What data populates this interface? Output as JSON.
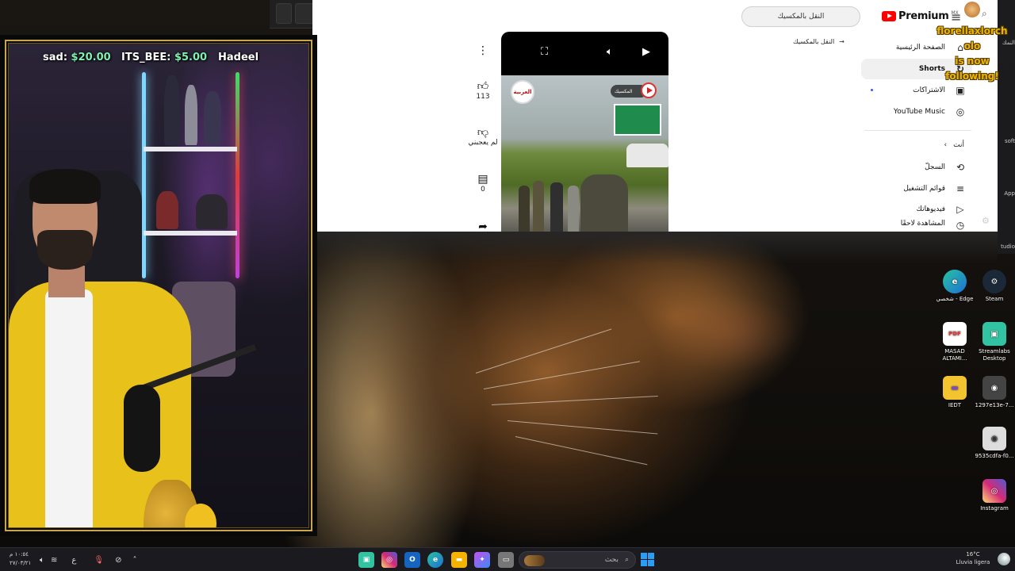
{
  "browser": {
    "address_text": "النقل بالمكسيك"
  },
  "youtube": {
    "logo_text": "Premium",
    "region": "MX",
    "back_link": "النقل بالمكسيك",
    "sidebar": [
      {
        "label": "الصفحة الرئيسية",
        "icon": "home-icon",
        "glyph": "⌂"
      },
      {
        "label": "Shorts",
        "icon": "shorts-icon",
        "glyph": "↻"
      },
      {
        "label": "الاشتراكات",
        "icon": "subscriptions-icon",
        "glyph": "▣"
      },
      {
        "label": "YouTube Music",
        "icon": "music-icon",
        "glyph": "◎"
      }
    ],
    "you_section": {
      "label": "أنت",
      "chevron": "‹"
    },
    "you_items": [
      {
        "label": "السجلّ",
        "icon": "history-icon",
        "glyph": "⟲"
      },
      {
        "label": "قوائم التشغيل",
        "icon": "playlists-icon",
        "glyph": "≡"
      },
      {
        "label": "فيديوهاتك",
        "icon": "your-videos-icon",
        "glyph": "▷"
      },
      {
        "label": "المشاهدة لاحقًا",
        "icon": "watch-later-icon",
        "glyph": "◷"
      }
    ],
    "short": {
      "channel_logo": "العربية",
      "tag": "المكسيك",
      "like_count": "113",
      "dislike_label": "لم يعجبني",
      "comment_count": "0"
    }
  },
  "stream": {
    "donors": [
      {
        "name": "sad:",
        "amount": "$20.00"
      },
      {
        "name": "ITS_BEE:",
        "amount": "$5.00"
      },
      {
        "name": "Hadeel",
        "amount": ""
      }
    ],
    "follow_alert": {
      "lines": [
        "florellaxlorch",
        "olo",
        "is now",
        "following!"
      ]
    }
  },
  "desktop": {
    "partial_labels": [
      "النمك",
      "soft",
      "App",
      "tudio"
    ],
    "icons": [
      {
        "label": "شخصي - Edge",
        "glyph": "e",
        "color": "#1e88d6"
      },
      {
        "label": "Steam",
        "glyph": "⚙",
        "color": "#1b2838"
      },
      {
        "label": "MASAD ALTAMI...",
        "glyph": "PDF",
        "color": "#e53935"
      },
      {
        "label": "Streamlabs Desktop",
        "glyph": "▣",
        "color": "#31c3a2"
      },
      {
        "label": "IEDT",
        "glyph": "▬",
        "color": "#f4c430"
      },
      {
        "label": "1297e13e-7...",
        "glyph": "◉",
        "color": "#444444"
      },
      {
        "label": "9535cdfa-f0...",
        "glyph": "◉",
        "color": "#dddddd"
      },
      {
        "label": "Instagram",
        "glyph": "◎",
        "color": "#d62976"
      }
    ]
  },
  "taskbar": {
    "search_placeholder": "بحث",
    "clock_time": "١٠:٥٤ م",
    "clock_date": "٢٧/٠٣/٢١",
    "weather_temp": "16°C",
    "weather_desc": "Lluvia ligera",
    "lang": "ع"
  },
  "colors": {
    "frame_gold": "#c9a64a",
    "youtube_red": "#ff0000",
    "alert_yellow": "#e8b800"
  }
}
